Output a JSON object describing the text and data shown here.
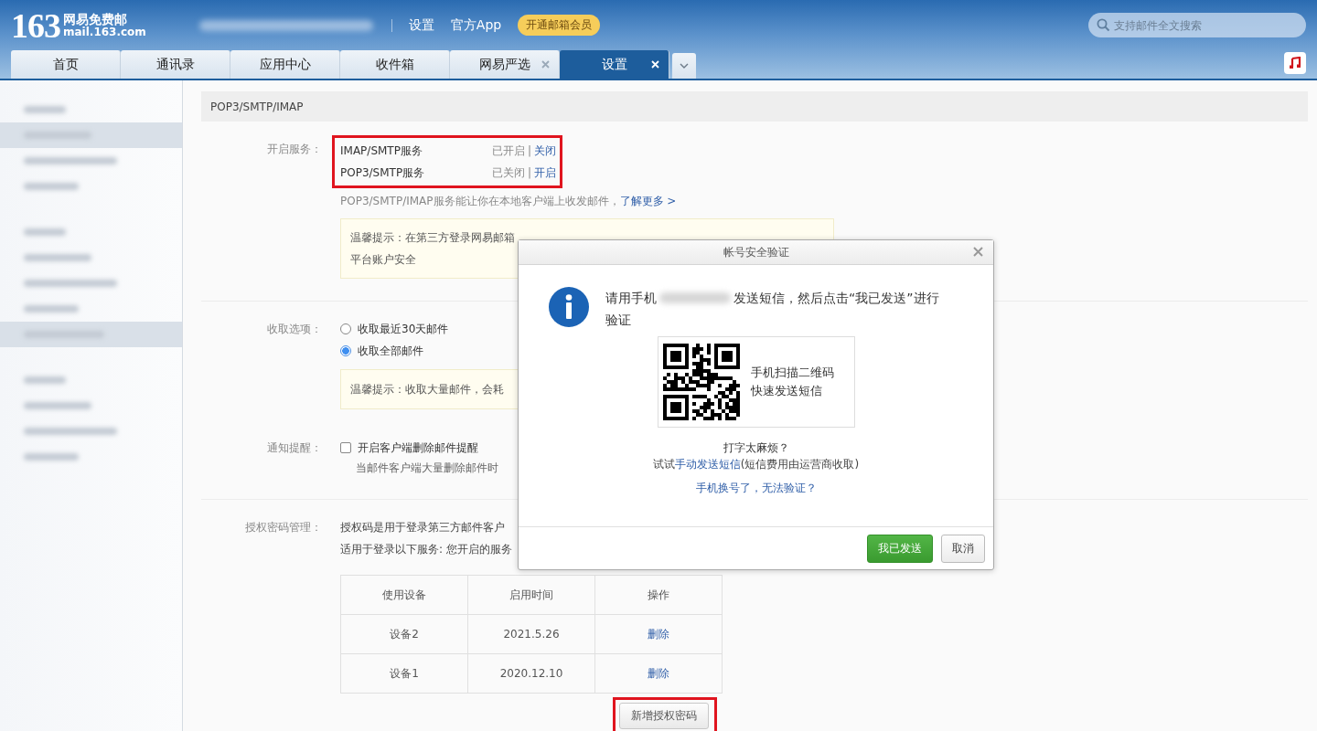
{
  "header": {
    "logo_number": "163",
    "logo_name": "网易免费邮",
    "logo_domain": "mail.163.com",
    "nav_links": [
      "设置",
      "官方App"
    ],
    "vip_badge": "开通邮箱会员",
    "search": {
      "placeholder": "支持邮件全文搜索"
    }
  },
  "tabs": [
    {
      "label": "首页",
      "selected": false,
      "closable": false
    },
    {
      "label": "通讯录",
      "selected": false,
      "closable": false
    },
    {
      "label": "应用中心",
      "selected": false,
      "closable": false
    },
    {
      "label": "收件箱",
      "selected": false,
      "closable": false
    },
    {
      "label": "网易严选",
      "selected": false,
      "closable": true
    },
    {
      "label": "设置",
      "selected": true,
      "closable": true
    }
  ],
  "sidebar": {
    "groups": [
      [
        {
          "selected": false
        },
        {
          "selected": true
        },
        {
          "selected": false
        },
        {
          "selected": false
        }
      ],
      [
        {
          "selected": false
        },
        {
          "selected": false
        },
        {
          "selected": false
        },
        {
          "selected": false
        },
        {
          "selected": true
        }
      ],
      [
        {
          "selected": false
        },
        {
          "selected": false
        },
        {
          "selected": false
        },
        {
          "selected": false
        }
      ]
    ]
  },
  "settings": {
    "section_title": "POP3/SMTP/IMAP",
    "services_label": "开启服务：",
    "services": [
      {
        "name": "IMAP/SMTP服务",
        "status": "已开启",
        "separator": "|",
        "action": "关闭"
      },
      {
        "name": "POP3/SMTP服务",
        "status": "已关闭",
        "separator": "|",
        "action": "开启"
      }
    ],
    "services_note": "POP3/SMTP/IMAP服务能让你在本地客户端上收发邮件，",
    "learn_more": "了解更多 >",
    "services_tip": [
      "温馨提示：在第三方登录网易邮箱",
      "平台账户安全"
    ],
    "fetch_label": "收取选项：",
    "fetch_options": [
      {
        "label": "收取最近30天邮件",
        "selected": false
      },
      {
        "label": "收取全部邮件",
        "selected": true
      }
    ],
    "fetch_tip": "温馨提示：收取大量邮件，会耗",
    "notify_label": "通知提醒：",
    "notify": {
      "label": "开启客户端删除邮件提醒",
      "checked": false
    },
    "notify_note": "当邮件客户端大量删除邮件时",
    "auth_label": "授权密码管理：",
    "auth_lines": [
      "授权码是用于登录第三方邮件客户",
      "适用于登录以下服务: 您开启的服务"
    ],
    "table": {
      "columns": [
        "使用设备",
        "启用时间",
        "操作"
      ],
      "rows": [
        {
          "device": "设备2",
          "date": "2021.5.26",
          "action": "删除"
        },
        {
          "device": "设备1",
          "date": "2020.12.10",
          "action": "删除"
        }
      ]
    },
    "add_button": "新增授权密码"
  },
  "dialog": {
    "title": "帐号安全验证",
    "message_start": "请用手机",
    "message_end": [
      "发送短信，然后点击“我已发送”进行",
      "验证"
    ],
    "qr_lines": [
      "手机扫描二维码",
      "快速发送短信"
    ],
    "hint": "打字太麻烦？",
    "try_prefix": "试试",
    "try_link": "手动发送短信",
    "try_suffix": "(短信费用由运营商收取)",
    "changed_link": "手机换号了，无法验证？",
    "buttons": [
      {
        "label": "我已发送",
        "kind": "primary"
      },
      {
        "label": "取消",
        "kind": "secondary"
      }
    ]
  }
}
